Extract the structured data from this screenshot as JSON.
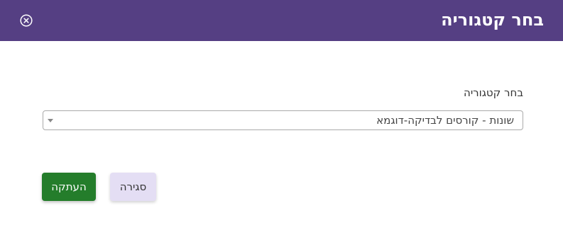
{
  "dialog": {
    "title": "בחר קטגוריה",
    "close_icon": "close-circle-icon",
    "header_color": "#553f83"
  },
  "form": {
    "category_label": "בחר קטגוריה",
    "category_selected": "שונות - קורסים לבדיקה-דוגמא"
  },
  "actions": {
    "copy_label": "העתקה",
    "close_label": "סגירה",
    "copy_color": "#247d2b",
    "close_color": "#e4def4"
  }
}
